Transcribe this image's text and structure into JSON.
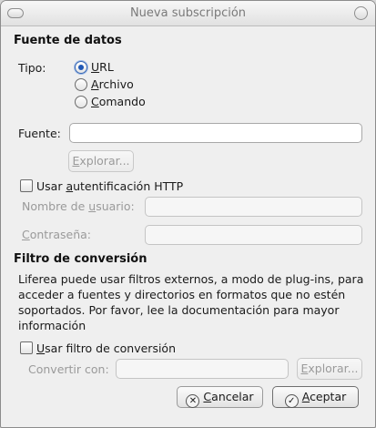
{
  "window": {
    "title": "Nueva subscripción"
  },
  "source_section": {
    "title": "Fuente de datos",
    "type_label": "Tipo:",
    "options": [
      {
        "mnemonic": "U",
        "rest": "RL",
        "checked": true
      },
      {
        "mnemonic": "A",
        "rest": "rchivo",
        "checked": false
      },
      {
        "mnemonic": "C",
        "rest": "omando",
        "checked": false
      }
    ],
    "source_label": "Fuente:",
    "source_value": "",
    "browse_mnemonic": "E",
    "browse_rest": "xplorar...",
    "auth_pre": "Usar ",
    "auth_mnemonic": "a",
    "auth_rest": "utentificación HTTP",
    "auth_checked": false,
    "username_pre": "Nombre de ",
    "username_mnemonic": "u",
    "username_rest": "suario:",
    "password_mnemonic": "C",
    "password_rest": "ontraseña:"
  },
  "filter_section": {
    "title": "Filtro de conversión",
    "description": "Liferea puede usar filtros externos, a modo de plug-ins, para acceder a fuentes y directorios en formatos que no estén soportados. Por favor, lee la documentación para mayor información",
    "use_filter_pre": "",
    "use_filter_mnemonic": "U",
    "use_filter_rest": "sar filtro de conversión",
    "use_filter_checked": false,
    "convert_label": "Convertir con:",
    "browse_mnemonic": "E",
    "browse_rest": "xplorar..."
  },
  "footer": {
    "cancel_mnemonic": "C",
    "cancel_rest": "ancelar",
    "accept_mnemonic": "A",
    "accept_rest": "ceptar"
  },
  "icons": {
    "cancel": "cancel-circle-icon",
    "accept": "checkmark-circle-icon"
  }
}
